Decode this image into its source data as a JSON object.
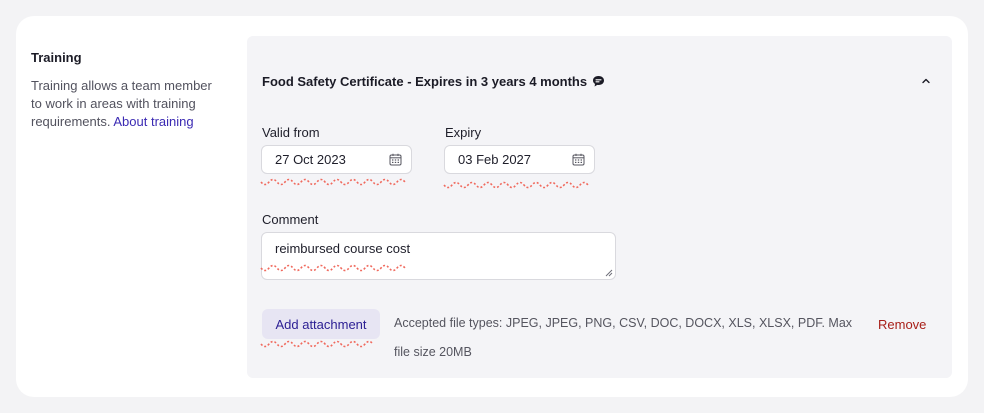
{
  "side": {
    "title": "Training",
    "description": "Training allows a team member to work in areas with training requirements.",
    "link": "About training"
  },
  "certificate": {
    "title": "Food Safety Certificate - Expires in 3 years 4 months"
  },
  "valid_from": {
    "label": "Valid from",
    "value": "27 Oct 2023"
  },
  "expiry": {
    "label": "Expiry",
    "value": "03 Feb 2027"
  },
  "comment": {
    "label": "Comment",
    "value": "reimbursed course cost"
  },
  "attachment": {
    "button": "Add attachment",
    "accepted": "Accepted file types: JPEG, JPEG, PNG, CSV, DOC, DOCX, XLS, XLSX, PDF. Max file size 20MB",
    "remove": "Remove"
  },
  "colors": {
    "accent": "#3b2ab3",
    "danger": "#a8201a",
    "squiggle": "#f06a5e"
  },
  "icons": [
    "comment-icon",
    "chevron-up-icon",
    "calendar-icon",
    "resize-handle-icon"
  ]
}
